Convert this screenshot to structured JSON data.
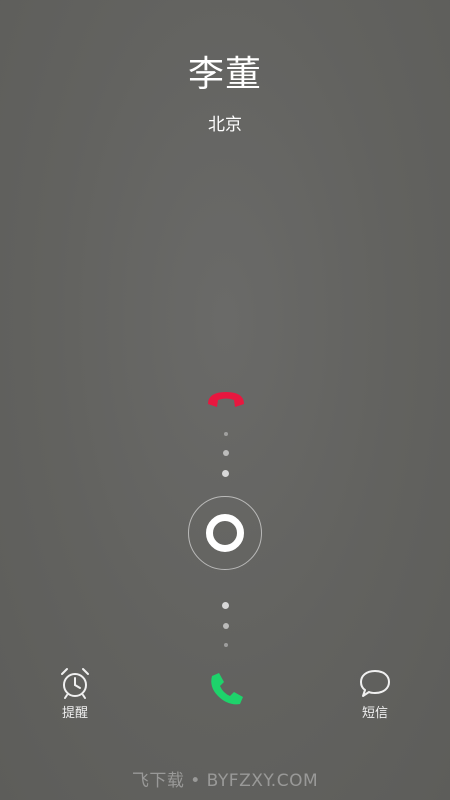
{
  "caller": {
    "name": "李董",
    "location": "北京"
  },
  "actions": {
    "decline_icon": "hangup-icon",
    "answer_icon": "phone-icon",
    "decline_color": "#e8173f",
    "answer_color": "#1ed36b",
    "reminder": {
      "label": "提醒",
      "icon": "alarm-clock-icon"
    },
    "message": {
      "label": "短信",
      "icon": "speech-bubble-icon"
    }
  },
  "watermark": "飞下载 • BYFZXY.COM"
}
